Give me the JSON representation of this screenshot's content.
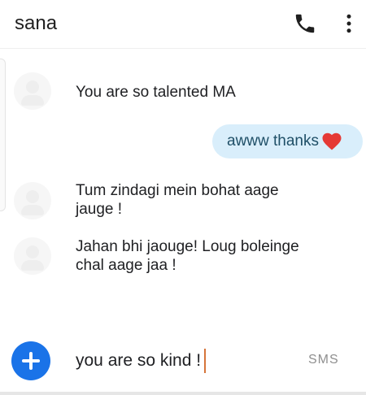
{
  "header": {
    "contact_name": "sana",
    "icons": [
      "phone-icon",
      "more-vert-icon"
    ]
  },
  "messages": [
    {
      "direction": "received",
      "text": "You are so talented MA"
    },
    {
      "direction": "sent",
      "text": "awww thanks",
      "emoji": "heart-icon"
    },
    {
      "direction": "received",
      "text": "Tum zindagi mein bohat aage jauge !"
    },
    {
      "direction": "received",
      "text": "Jahan bhi jaouge! Loug boleinge chal aage jaa !"
    }
  ],
  "composer": {
    "add_icon": "add-icon",
    "input_value": "you are so kind !",
    "send_mode_label": "SMS"
  },
  "colors": {
    "accent": "#1a73e8",
    "sent_bubble": "#d9eefb",
    "sent_text": "#1f4f67",
    "heart": "#e53935",
    "caret": "#d6753a"
  }
}
